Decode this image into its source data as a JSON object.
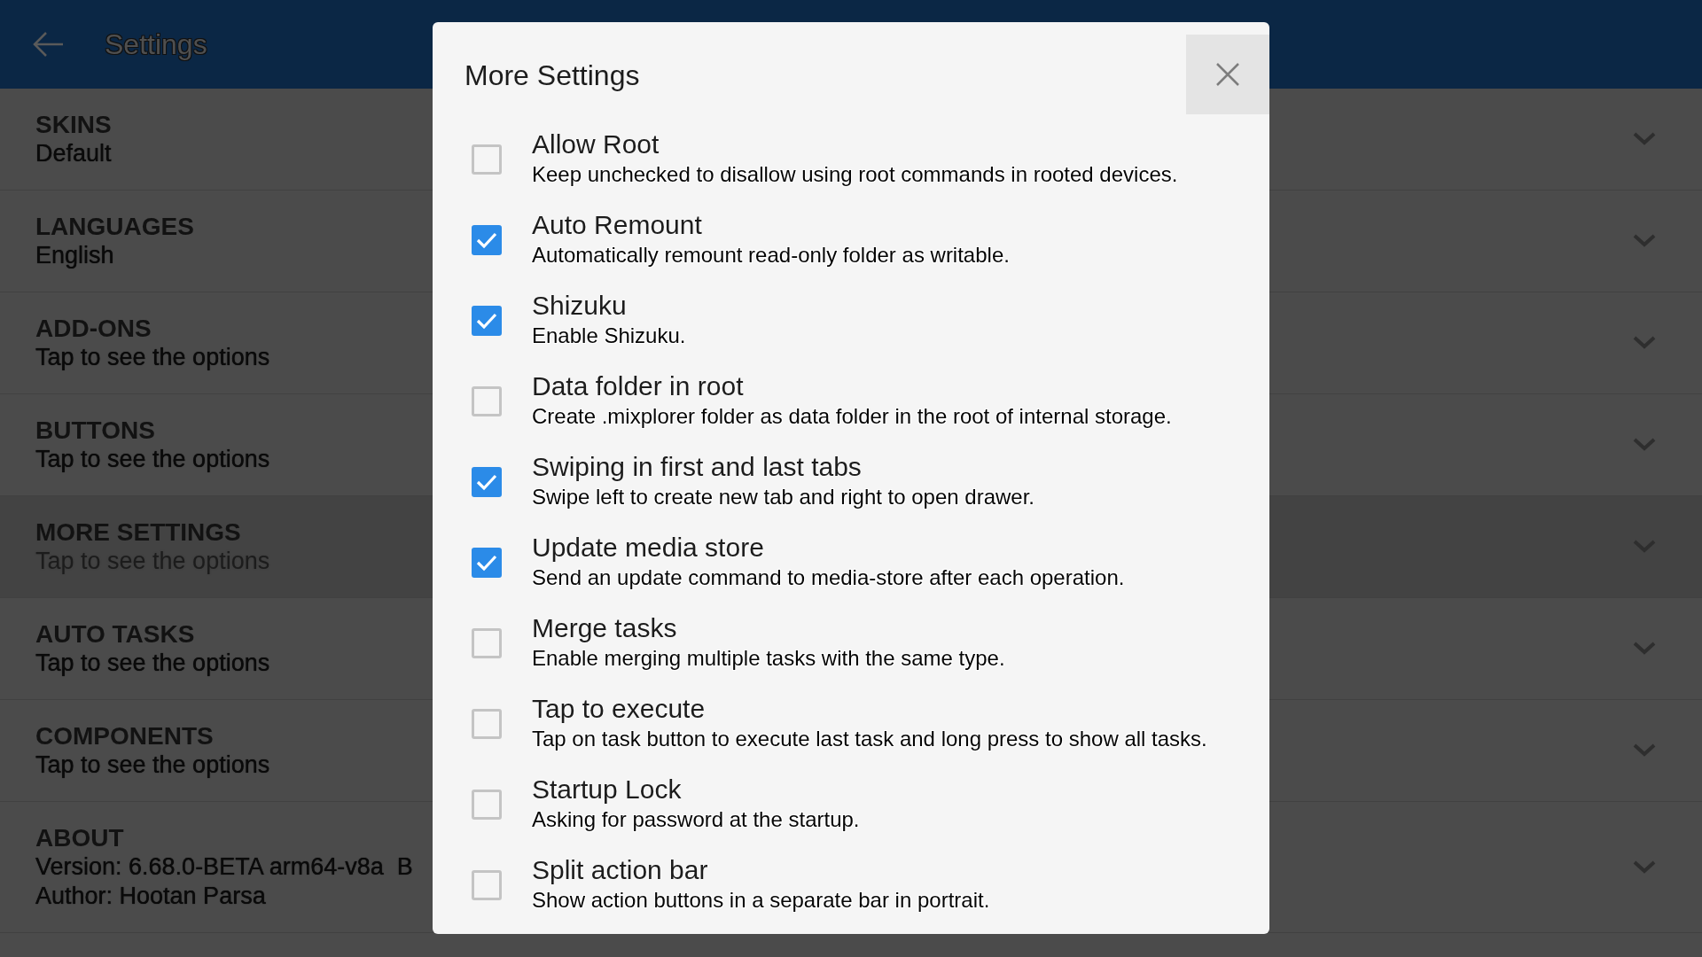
{
  "app_bar": {
    "title": "Settings"
  },
  "sections": [
    {
      "title": "SKINS",
      "lines": [
        "Default"
      ],
      "selected": false
    },
    {
      "title": "LANGUAGES",
      "lines": [
        "English"
      ],
      "selected": false
    },
    {
      "title": "ADD-ONS",
      "lines": [
        "Tap to see the options"
      ],
      "selected": false
    },
    {
      "title": "BUTTONS",
      "lines": [
        "Tap to see the options"
      ],
      "selected": false
    },
    {
      "title": "MORE SETTINGS",
      "lines": [
        "Tap to see the options"
      ],
      "selected": true
    },
    {
      "title": "AUTO TASKS",
      "lines": [
        "Tap to see the options"
      ],
      "selected": false
    },
    {
      "title": "COMPONENTS",
      "lines": [
        "Tap to see the options"
      ],
      "selected": false
    },
    {
      "title": "ABOUT",
      "lines": [
        "Version: 6.68.0-BETA arm64-v8a  B",
        "Author: Hootan Parsa"
      ],
      "selected": false
    }
  ],
  "dialog": {
    "title": "More Settings",
    "options": [
      {
        "label": "Allow Root",
        "description": "Keep unchecked to disallow using root commands in rooted devices.",
        "checked": false
      },
      {
        "label": "Auto Remount",
        "description": "Automatically remount read-only folder as writable.",
        "checked": true
      },
      {
        "label": "Shizuku",
        "description": "Enable Shizuku.",
        "checked": true
      },
      {
        "label": "Data folder in root",
        "description": "Create .mixplorer folder as data folder in the root of internal storage.",
        "checked": false
      },
      {
        "label": "Swiping in first and last tabs",
        "description": "Swipe left to create new tab and right to open drawer.",
        "checked": true
      },
      {
        "label": "Update media store",
        "description": "Send an update command to media-store after each operation.",
        "checked": true
      },
      {
        "label": "Merge tasks",
        "description": "Enable merging multiple tasks with the same type.",
        "checked": false
      },
      {
        "label": "Tap to execute",
        "description": "Tap on task button to execute last task and long press to show all tasks.",
        "checked": false
      },
      {
        "label": "Startup Lock",
        "description": "Asking for password at the startup.",
        "checked": false
      },
      {
        "label": "Split action bar",
        "description": "Show action buttons in a separate bar in portrait.",
        "checked": false
      }
    ]
  }
}
